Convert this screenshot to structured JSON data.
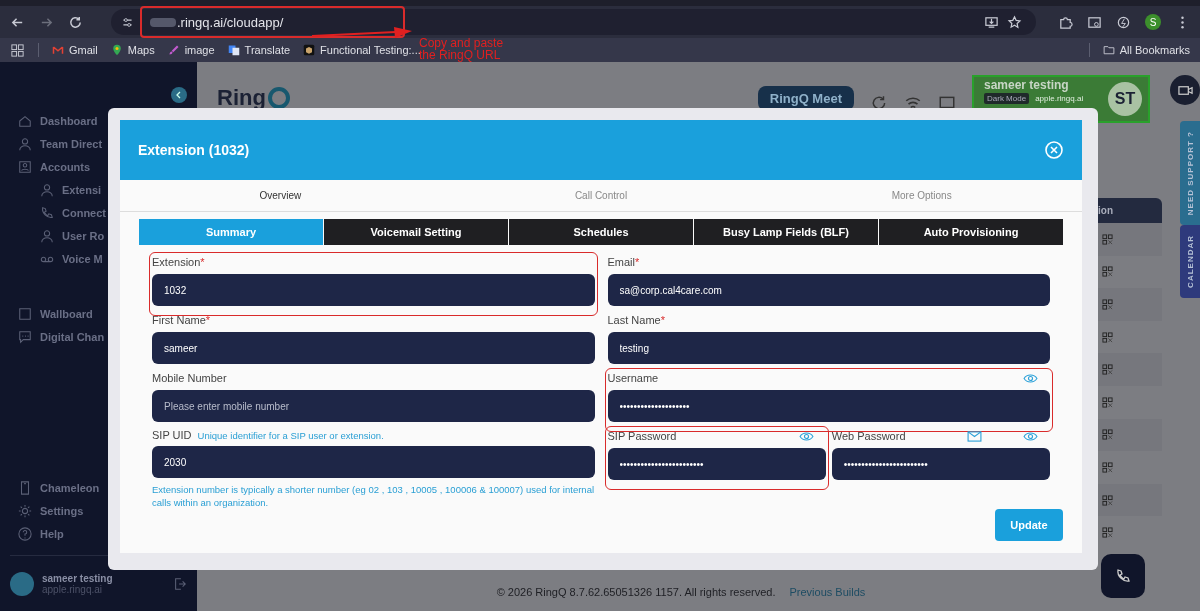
{
  "browser": {
    "address_bar": {
      "url": ".ringq.ai/cloudapp/",
      "highlighted": true
    },
    "profile_initial": "S",
    "bookmarks": [
      {
        "label": "Gmail"
      },
      {
        "label": "Maps"
      },
      {
        "label": "image"
      },
      {
        "label": "Translate"
      },
      {
        "label": "Functional Testing:..."
      }
    ],
    "all_bookmarks": "All Bookmarks"
  },
  "callout": "Copy and paste the RingQ URL",
  "sidebar": {
    "groups": [
      {
        "items": [
          {
            "label": "Dashboard"
          },
          {
            "label": "Team Direct"
          },
          {
            "label": "Accounts",
            "children": [
              {
                "label": "Extensi"
              },
              {
                "label": "Connect"
              },
              {
                "label": "User Ro"
              },
              {
                "label": "Voice M"
              }
            ]
          }
        ]
      },
      {
        "items": [
          {
            "label": "Wallboard"
          },
          {
            "label": "Digital Chan"
          }
        ]
      },
      {
        "items": [
          {
            "label": "Chameleon"
          },
          {
            "label": "Settings"
          },
          {
            "label": "Help"
          }
        ]
      }
    ],
    "user": {
      "name": "sameer testing",
      "domain": "apple.ringq.ai"
    }
  },
  "header": {
    "logo": "Ring",
    "meet_button": "RingQ Meet",
    "user": {
      "name": "sameer testing",
      "mode_badge": "Dark Mode",
      "domain": "apple.ringq.ai",
      "initials": "ST"
    }
  },
  "table": {
    "column_header": "ion"
  },
  "side_tabs": [
    {
      "label": "NEED SUPPORT ?",
      "color": "#2a6d8f"
    },
    {
      "label": "CALENDAR",
      "color": "#2e3a7c"
    }
  ],
  "modal": {
    "title": "Extension (1032)",
    "tabs": [
      {
        "label": "Overview",
        "selected": true
      },
      {
        "label": "Call Control",
        "selected": false
      },
      {
        "label": "More Options",
        "selected": false
      }
    ],
    "subtabs": [
      {
        "label": "Summary",
        "selected": true
      },
      {
        "label": "Voicemail Setting",
        "selected": false
      },
      {
        "label": "Schedules",
        "selected": false
      },
      {
        "label": "Busy Lamp Fields (BLF)",
        "selected": false
      },
      {
        "label": "Auto Provisioning",
        "selected": false
      }
    ],
    "rows": [
      {
        "left": [
          {
            "label": "Extension",
            "mark": "*",
            "value": "1032",
            "highlighted": true
          }
        ],
        "right": [
          {
            "label": "Email",
            "mark": "*",
            "value": "sa@corp.cal4care.com"
          }
        ]
      },
      {
        "left": [
          {
            "label": "First Name",
            "mark": "*",
            "value": "sameer"
          }
        ],
        "right": [
          {
            "label": "Last Name",
            "mark": "*",
            "value": "testing"
          }
        ]
      },
      {
        "left": [
          {
            "label": "Mobile Number",
            "placeholder": "Please enter mobile number"
          }
        ],
        "right": [
          {
            "label": "Username",
            "value": "••••••••••••••••••••",
            "reveal_icon": true,
            "highlighted": true
          }
        ]
      },
      {
        "left": [
          {
            "label": "SIP UID",
            "hint": "Unique identifier for a SIP user or extension.",
            "value": "2030",
            "note": "Extension number is typically a shorter number (eg 02 , 103 , 10005 , 100006 & 100007) used for internal calls within an organization."
          }
        ],
        "right": [
          {
            "label": "SIP Password",
            "value": "••••••••••••••••••••••••",
            "reveal_icon": true,
            "highlighted": true
          },
          {
            "label": "Web Password",
            "value": "••••••••••••••••••••••••",
            "mail_icon": true,
            "reveal_icon": true
          }
        ]
      }
    ],
    "update_button": "Update"
  },
  "footer": {
    "copyright": "© 2026 RingQ 8.7.62.65051326 1157. All rights reserved.",
    "link": "Previous Builds"
  }
}
